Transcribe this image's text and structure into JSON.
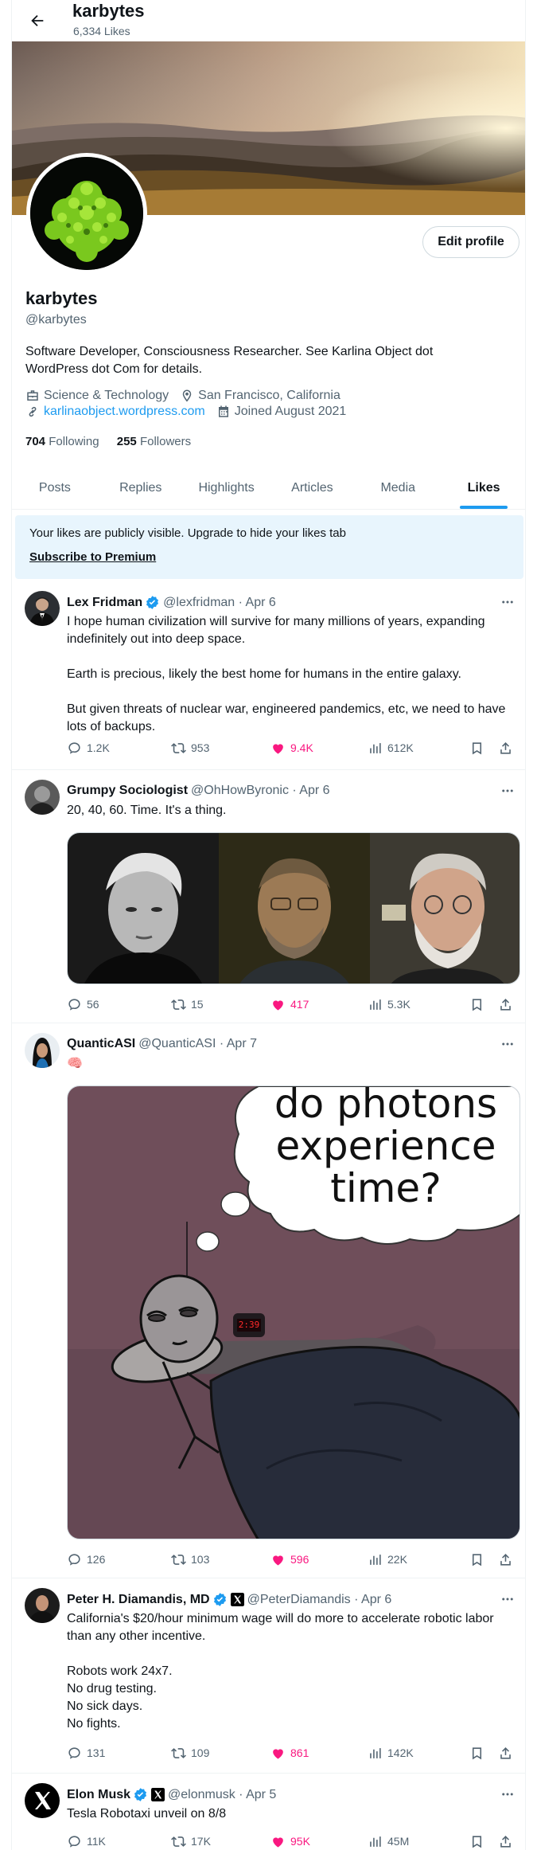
{
  "header": {
    "title": "karbytes",
    "subtitle": "6,334 Likes"
  },
  "profile": {
    "edit_label": "Edit profile",
    "name": "karbytes",
    "handle": "@karbytes",
    "bio": "Software Developer, Consciousness Researcher. See Karlina Object dot WordPress dot Com for details.",
    "category": "Science & Technology",
    "location": "San Francisco, California",
    "website": "karlinaobject.wordpress.com",
    "joined": "Joined August 2021",
    "following_count": "704",
    "following_label": "Following",
    "followers_count": "255",
    "followers_label": "Followers"
  },
  "tabs": [
    "Posts",
    "Replies",
    "Highlights",
    "Articles",
    "Media",
    "Likes"
  ],
  "active_tab": "Likes",
  "notice": {
    "text": "Your likes are publicly visible. Upgrade to hide your likes tab",
    "link": "Subscribe to Premium"
  },
  "tweets": [
    {
      "name": "Lex Fridman",
      "verified": true,
      "handle": "@lexfridman · Apr 6",
      "text": "I hope human civilization will survive for many millions of years, expanding indefinitely out into deep space.\n\nEarth is precious, likely the best home for humans in the entire galaxy.\n\nBut given threats of nuclear war, engineered pandemics, etc, we need to have lots of backups.",
      "replies": "1.2K",
      "reposts": "953",
      "likes": "9.4K",
      "views": "612K"
    },
    {
      "name": "Grumpy Sociologist",
      "verified": false,
      "handle": "@OhHowByronic · Apr 6",
      "text": "20, 40, 60. Time. It's a thing.",
      "replies": "56",
      "reposts": "15",
      "likes": "417",
      "views": "5.3K"
    },
    {
      "name": "QuanticASI",
      "verified": false,
      "handle": "@QuanticASI · Apr 7",
      "text": "🧠",
      "image_text": "do photons\nexperience\ntime?",
      "clock_text": "2:39",
      "replies": "126",
      "reposts": "103",
      "likes": "596",
      "views": "22K"
    },
    {
      "name": "Peter H. Diamandis, MD",
      "verified": true,
      "handle": "@PeterDiamandis · Apr 6",
      "text": "California's $20/hour minimum wage will do more to accelerate robotic labor than any other incentive.\n\nRobots work 24x7.\nNo drug testing.\nNo sick days.\nNo fights.",
      "replies": "131",
      "reposts": "109",
      "likes": "861",
      "views": "142K"
    },
    {
      "name": "Elon Musk",
      "verified": true,
      "handle": "@elonmusk · Apr 5",
      "text": "Tesla Robotaxi unveil on 8/8",
      "replies": "11K",
      "reposts": "17K",
      "likes": "95K",
      "views": "45M"
    }
  ],
  "colors": {
    "accent": "#1d9bf0",
    "like": "#f91880",
    "secondary_text": "#536471",
    "notice_bg": "#e8f5fd"
  }
}
